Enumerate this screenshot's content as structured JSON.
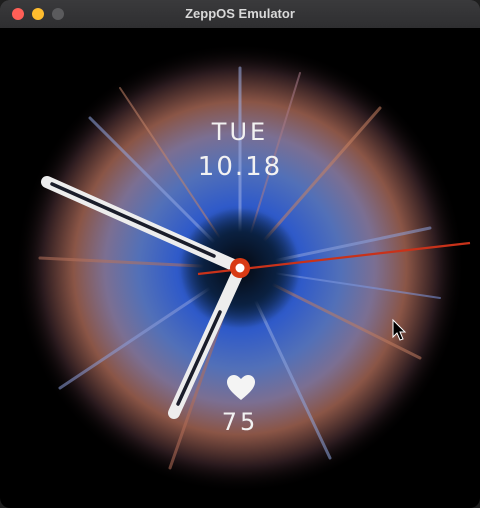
{
  "window": {
    "title": "ZeppOS Emulator"
  },
  "watchface": {
    "day": "TUE",
    "date": "10.18",
    "heart_rate": "75",
    "colors": {
      "accent": "#d83a14",
      "hands": "#ededed",
      "nebula_blue": "#3a5fd0",
      "nebula_orange": "#c86a44"
    }
  },
  "icons": {
    "heart": "heart-icon",
    "cursor": "mouse-cursor-icon"
  }
}
